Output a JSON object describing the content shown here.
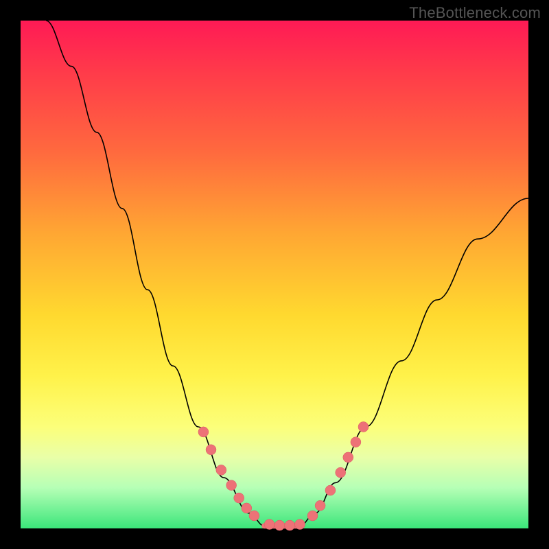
{
  "watermark": "TheBottleneck.com",
  "colors": {
    "background": "#000000",
    "dot_fill": "#ed7277",
    "dot_stroke": "#d85a60",
    "curve": "#000000",
    "gradient_top": "#ff1a55",
    "gradient_bottom": "#3be67a"
  },
  "chart_data": {
    "type": "line",
    "title": "",
    "xlabel": "",
    "ylabel": "",
    "xlim": [
      0,
      100
    ],
    "ylim": [
      0,
      100
    ],
    "grid": false,
    "legend": false,
    "curve_points": [
      {
        "x": 5,
        "y": 100
      },
      {
        "x": 10,
        "y": 91
      },
      {
        "x": 15,
        "y": 78
      },
      {
        "x": 20,
        "y": 63
      },
      {
        "x": 25,
        "y": 47
      },
      {
        "x": 30,
        "y": 32
      },
      {
        "x": 35,
        "y": 20
      },
      {
        "x": 40,
        "y": 10
      },
      {
        "x": 45,
        "y": 3
      },
      {
        "x": 48,
        "y": 0.5
      },
      {
        "x": 50,
        "y": 0
      },
      {
        "x": 52,
        "y": 0
      },
      {
        "x": 55,
        "y": 0.5
      },
      {
        "x": 58,
        "y": 3
      },
      {
        "x": 62,
        "y": 9
      },
      {
        "x": 68,
        "y": 20
      },
      {
        "x": 75,
        "y": 33
      },
      {
        "x": 82,
        "y": 45
      },
      {
        "x": 90,
        "y": 57
      },
      {
        "x": 100,
        "y": 65
      }
    ],
    "highlighted_points": [
      {
        "x": 36,
        "y": 19
      },
      {
        "x": 37.5,
        "y": 15.5
      },
      {
        "x": 39.5,
        "y": 11.5
      },
      {
        "x": 41.5,
        "y": 8.5
      },
      {
        "x": 43,
        "y": 6
      },
      {
        "x": 44.5,
        "y": 4
      },
      {
        "x": 46,
        "y": 2.5
      },
      {
        "x": 49,
        "y": 0.8
      },
      {
        "x": 51,
        "y": 0.6
      },
      {
        "x": 53,
        "y": 0.6
      },
      {
        "x": 55,
        "y": 0.8
      },
      {
        "x": 57.5,
        "y": 2.5
      },
      {
        "x": 59,
        "y": 4.5
      },
      {
        "x": 61,
        "y": 7.5
      },
      {
        "x": 63,
        "y": 11
      },
      {
        "x": 64.5,
        "y": 14
      },
      {
        "x": 66,
        "y": 17
      },
      {
        "x": 67.5,
        "y": 20
      }
    ],
    "flat_bottom": {
      "x_start": 48,
      "x_end": 55,
      "y": 0.5
    }
  }
}
